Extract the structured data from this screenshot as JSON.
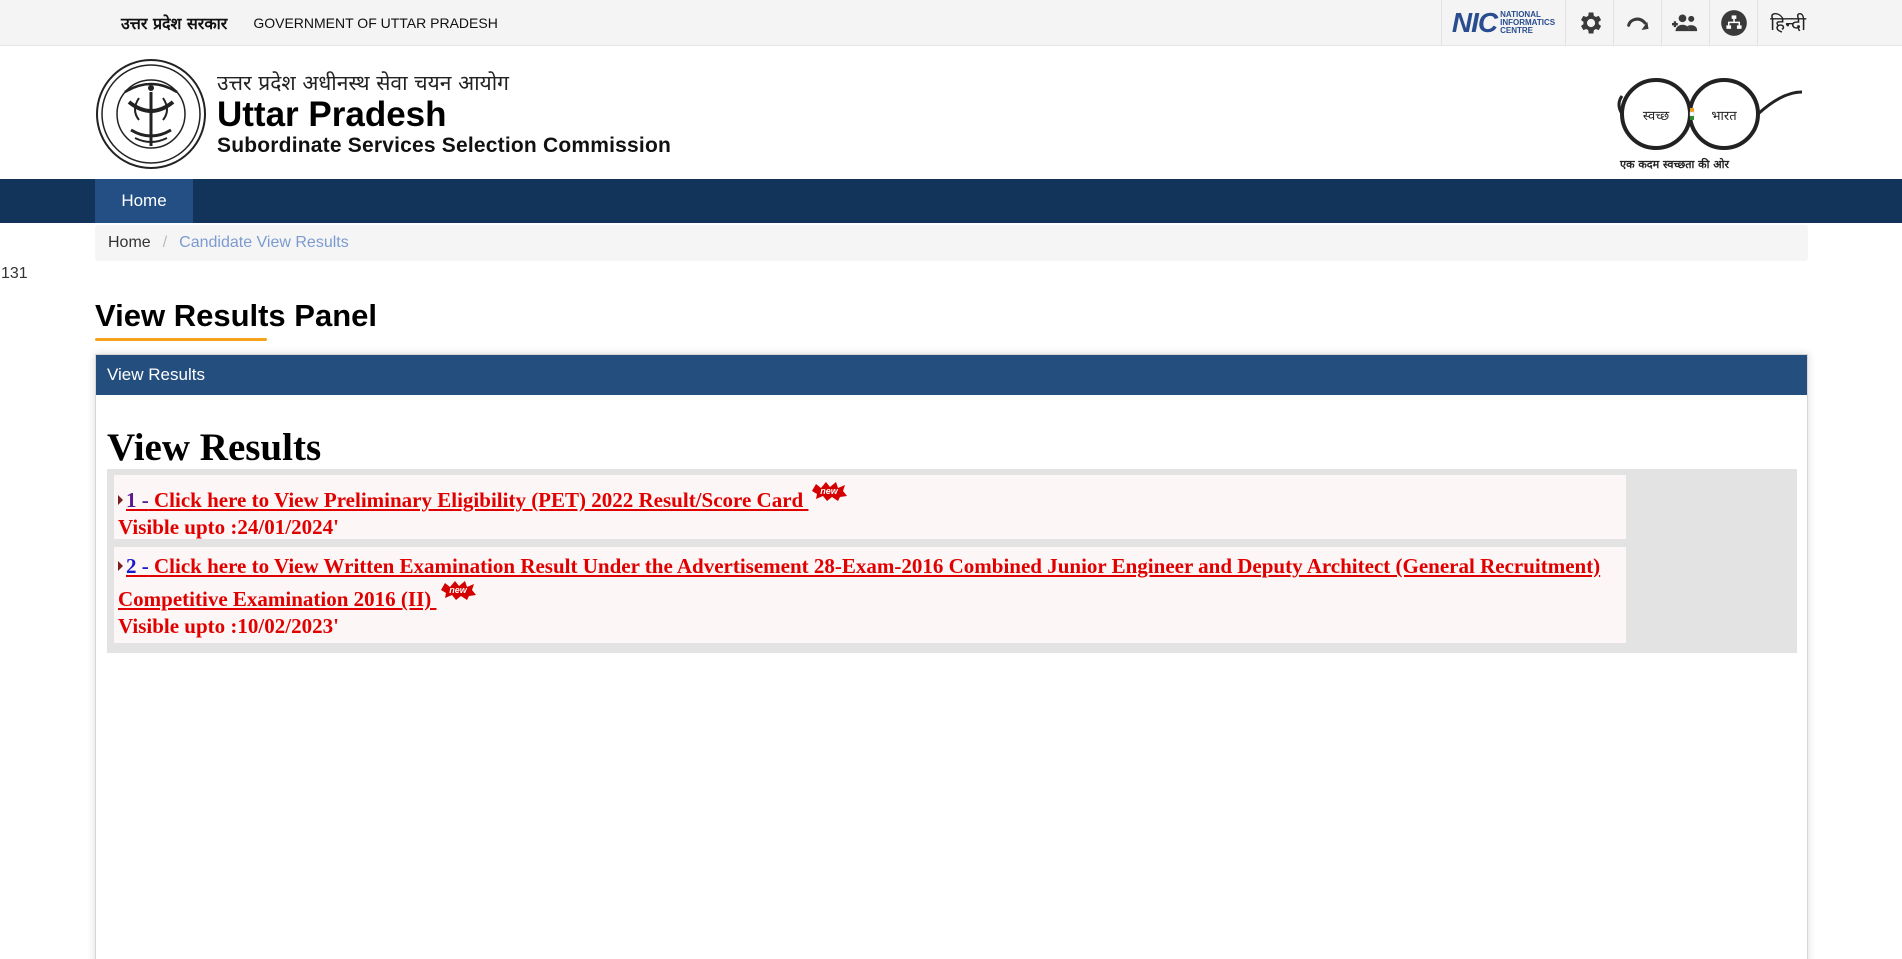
{
  "gov_bar": {
    "hindi_label": "उत्तर प्रदेश सरकार",
    "english_label": "GOVERNMENT OF UTTAR PRADESH",
    "nic_mark": "NIC",
    "nic_text": [
      "NATIONAL",
      "INFORMATICS",
      "CENTRE"
    ],
    "icons": [
      "settings-icon",
      "skip-to-content-icon",
      "users-icon",
      "sitemap-icon"
    ],
    "language_button": "हिन्दी"
  },
  "header": {
    "title_hindi": "उत्तर प्रदेश अधीनस्थ सेवा चयन आयोग",
    "title_main": "Uttar Pradesh",
    "title_sub": "Subordinate Services Selection Commission",
    "emblem_text": "उत्तर प्रदेश सरकार",
    "swachh_left": "स्वच्छ",
    "swachh_right": "भारत",
    "swachh_tagline": "एक कदम स्वच्छता की ओर"
  },
  "nav": {
    "home": "Home"
  },
  "breadcrumb": {
    "home": "Home",
    "separator": "/",
    "current": "Candidate View Results"
  },
  "stray_number": "131",
  "page": {
    "heading": "View Results Panel"
  },
  "panel": {
    "header": "View Results",
    "title": "View Results",
    "results": [
      {
        "number": "1 -",
        "link_text": "Click here to View Preliminary Eligibility (PET) 2022 Result/Score Card ",
        "badge": "new",
        "visible": "Visible upto :24/01/2024'"
      },
      {
        "number": "2 -",
        "link_text": "Click here to View Written Examination Result Under the Advertisement 28-Exam-2016 Combined Junior Engineer and Deputy Architect (General Recruitment) Competitive Examination 2016 (II) ",
        "badge": "new",
        "visible": "Visible upto :10/02/2023'"
      }
    ]
  },
  "colors": {
    "nav_bg": "#12335a",
    "nav_active": "#234f85",
    "panel_head": "#234e7e",
    "link_red": "#e00000",
    "accent_orange": "#f6a21a"
  }
}
